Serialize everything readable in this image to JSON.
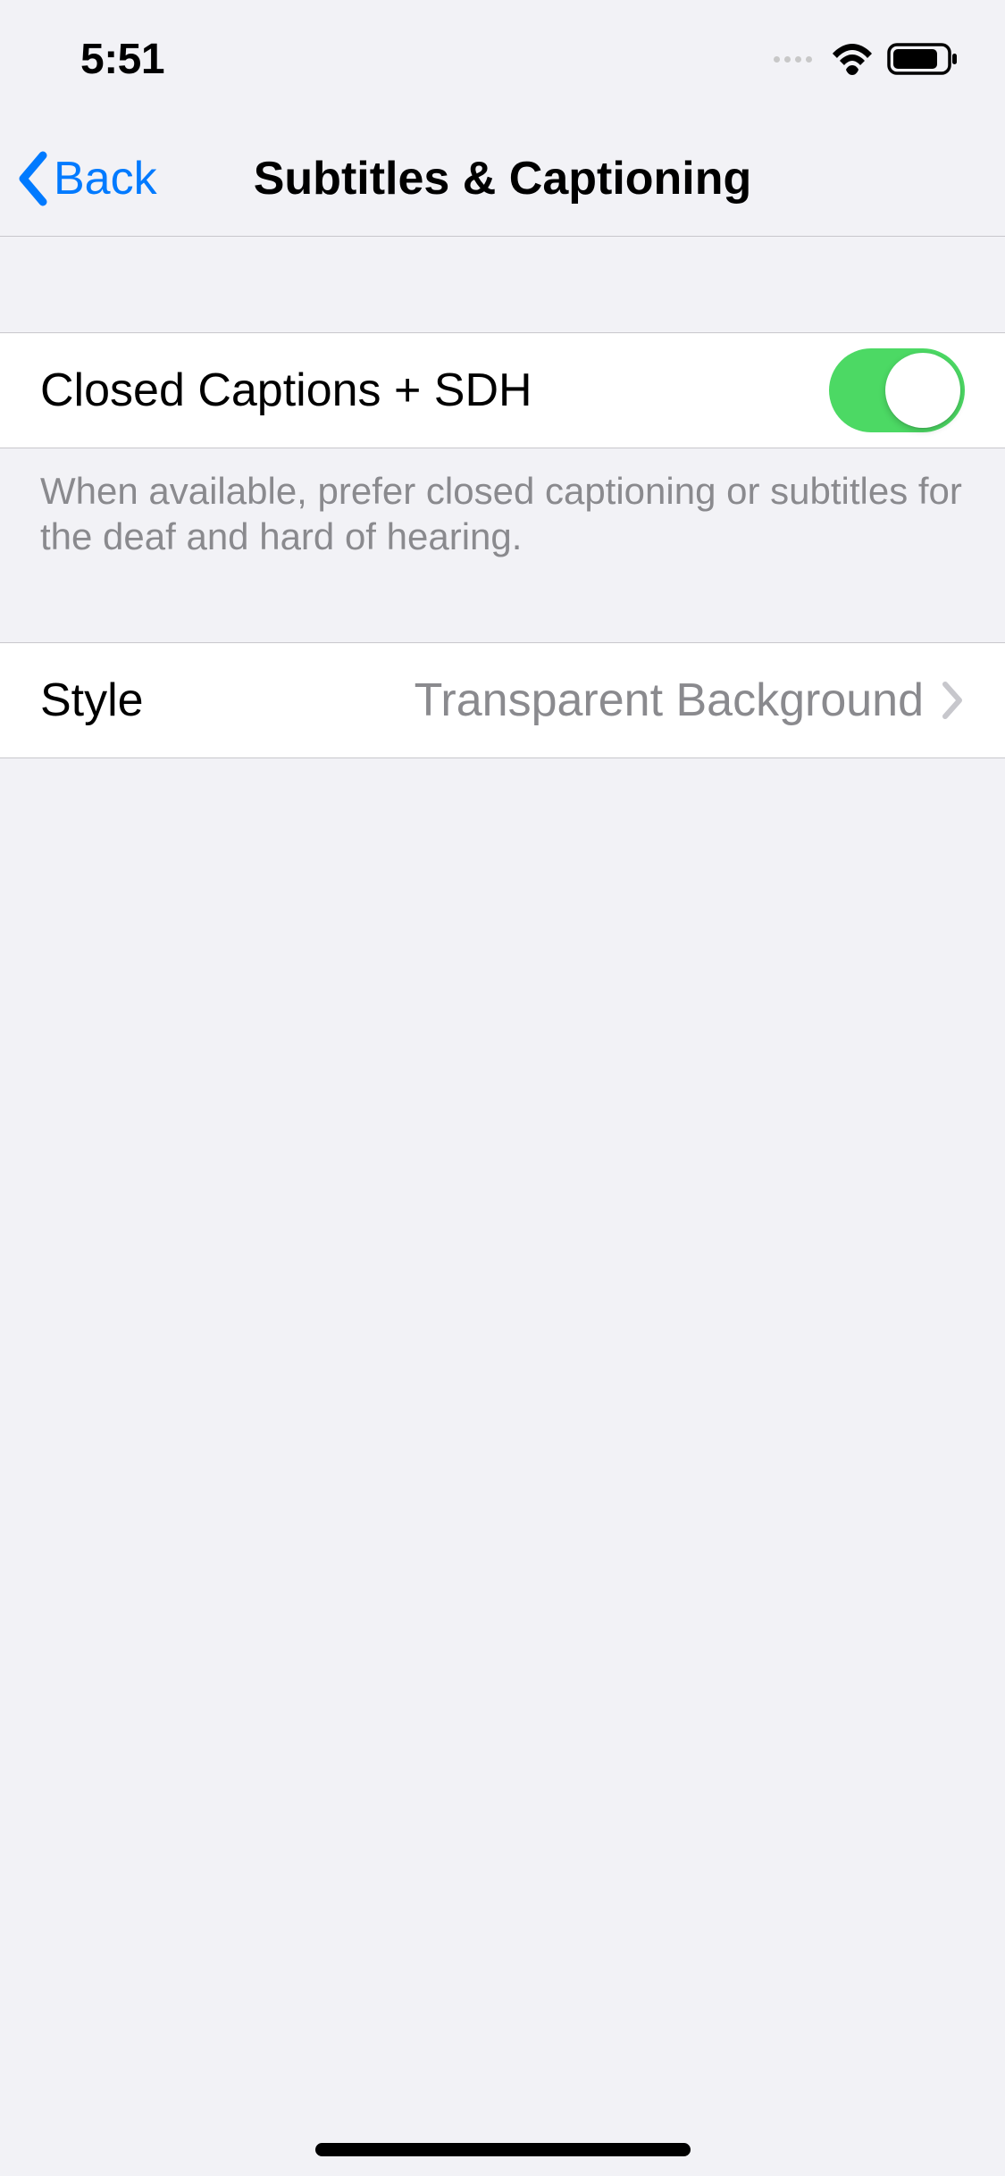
{
  "statusBar": {
    "time": "5:51"
  },
  "nav": {
    "back_label": "Back",
    "title": "Subtitles & Captioning"
  },
  "sections": {
    "closedCaptions": {
      "label": "Closed Captions + SDH",
      "enabled": true,
      "footer": "When available, prefer closed captioning or subtitles for the deaf and hard of hearing."
    },
    "style": {
      "label": "Style",
      "value": "Transparent Background"
    }
  }
}
